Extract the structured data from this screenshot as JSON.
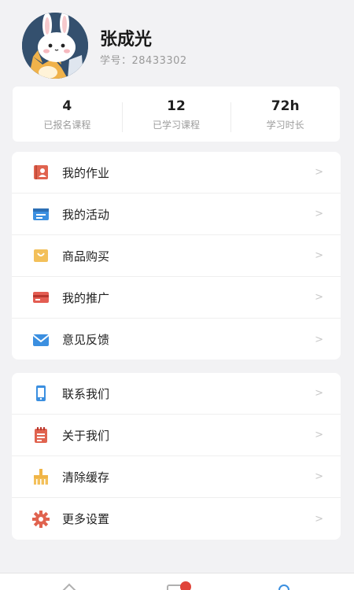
{
  "profile": {
    "name": "张成光",
    "student_id": "学号：28433302",
    "avatar_icon": "bunny-avatar-icon"
  },
  "stats": [
    {
      "value": "4",
      "label": "已报名课程"
    },
    {
      "value": "12",
      "label": "已学习课程"
    },
    {
      "value": "72h",
      "label": "学习时长"
    }
  ],
  "menu1": [
    {
      "label": "我的作业",
      "icon": "homework-icon",
      "color": "#e0634f"
    },
    {
      "label": "我的活动",
      "icon": "activity-icon",
      "color": "#3b8fe0"
    },
    {
      "label": "商品购买",
      "icon": "shopping-icon",
      "color": "#f3c05a"
    },
    {
      "label": "我的推广",
      "icon": "card-icon",
      "color": "#e35d52"
    },
    {
      "label": "意见反馈",
      "icon": "mail-icon",
      "color": "#3b8fe0"
    }
  ],
  "menu2": [
    {
      "label": "联系我们",
      "icon": "phone-icon",
      "color": "#3b8fe0"
    },
    {
      "label": "关于我们",
      "icon": "notebook-icon",
      "color": "#e0634f"
    },
    {
      "label": "清除缓存",
      "icon": "broom-icon",
      "color": "#f0b547"
    },
    {
      "label": "更多设置",
      "icon": "gear-icon",
      "color": "#e0634f"
    }
  ],
  "chevron": ">",
  "colors": {
    "background": "#f2f2f4",
    "card": "#ffffff",
    "accent_blue": "#3b8fe0",
    "badge_red": "#e0443a"
  }
}
